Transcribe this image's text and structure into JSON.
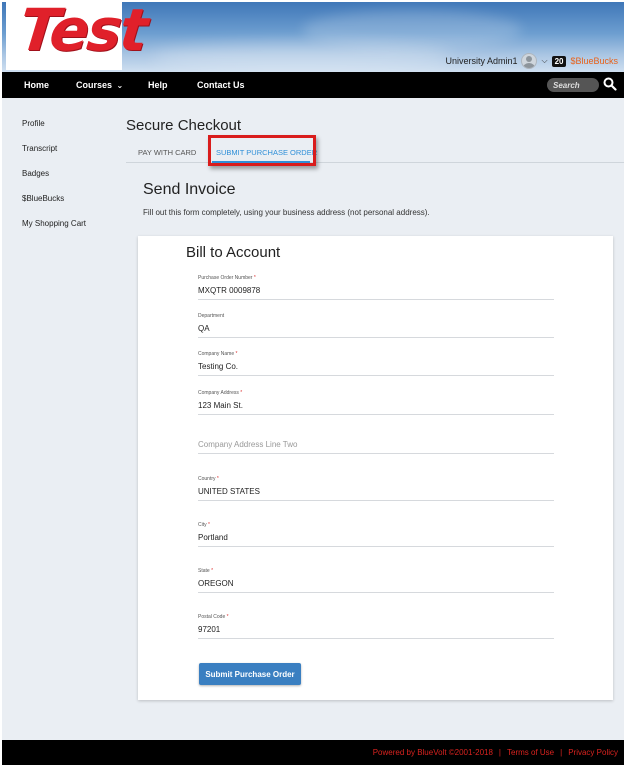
{
  "header": {
    "logo_text": "Test",
    "user_name": "University Admin1",
    "bucks_count": "20",
    "bucks_label": "$BlueBucks"
  },
  "nav": {
    "items": [
      {
        "label": "Home"
      },
      {
        "label": "Courses"
      },
      {
        "label": "Help"
      },
      {
        "label": "Contact Us"
      }
    ],
    "courses_caret": "⌄",
    "search_placeholder": "Search"
  },
  "sidebar": {
    "items": [
      {
        "label": "Profile"
      },
      {
        "label": "Transcript"
      },
      {
        "label": "Badges"
      },
      {
        "label": "$BlueBucks"
      },
      {
        "label": "My Shopping Cart"
      }
    ]
  },
  "checkout": {
    "title": "Secure Checkout",
    "tabs": [
      {
        "label": "PAY WITH CARD",
        "active": false
      },
      {
        "label": "SUBMIT PURCHASE ORDER",
        "active": true
      }
    ],
    "section_title": "Send Invoice",
    "section_desc": "Fill out this form completely, using your business address (not personal address)."
  },
  "form": {
    "title": "Bill to Account",
    "fields": [
      {
        "label": "Purchase Order Number",
        "required": "*",
        "value": "MXQTR 0009878"
      },
      {
        "label": "Department",
        "required": "",
        "value": "QA"
      },
      {
        "label": "Company Name",
        "required": "*",
        "value": "Testing Co."
      },
      {
        "label": "Company Address",
        "required": "*",
        "value": "123 Main St."
      },
      {
        "label": "",
        "required": "",
        "value": "",
        "placeholder": "Company Address Line Two"
      },
      {
        "label": "Country",
        "required": "*",
        "value": "UNITED STATES"
      },
      {
        "label": "City",
        "required": "*",
        "value": "Portland"
      },
      {
        "label": "State",
        "required": "*",
        "value": "OREGON"
      },
      {
        "label": "Postal Code",
        "required": "*",
        "value": "97201"
      }
    ],
    "submit_label": "Submit Purchase Order"
  },
  "footer": {
    "powered_by": "Powered by BlueVolt ©2001-2018",
    "separator": "|",
    "terms": "Terms of Use",
    "privacy": "Privacy Policy"
  },
  "colors": {
    "accent": "#2f8fd8",
    "highlight": "#d91c1c",
    "button": "#3a7fc1",
    "footer_text": "#d9231f",
    "bucks": "#e8621a"
  }
}
